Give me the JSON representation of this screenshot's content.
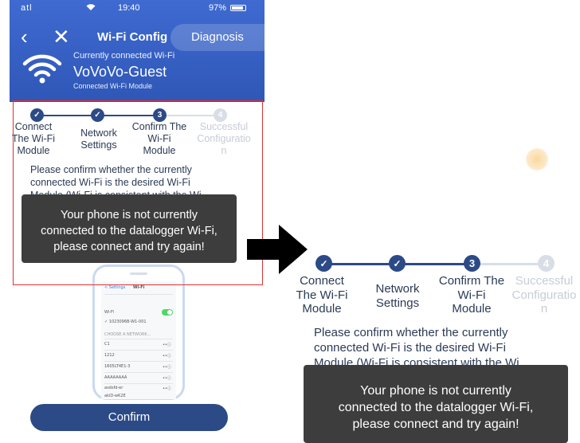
{
  "status_bar": {
    "signal": "atl",
    "time": "19:40",
    "battery": "97%"
  },
  "header": {
    "title": "Wi-Fi Config",
    "diagnosis_label": "Diagnosis",
    "current_label": "Currently connected Wi-Fi",
    "ssid": "VoVoVo-Guest",
    "subtitle": "Connected Wi-Fi Module"
  },
  "steps": [
    {
      "number": "1",
      "line1": "Connect",
      "line2": "The Wi-Fi",
      "line3": "Module",
      "state": "done"
    },
    {
      "number": "2",
      "line1": "Network",
      "line2": "Settings",
      "line3": "",
      "state": "done"
    },
    {
      "number": "3",
      "line1": "Confirm The",
      "line2": "Wi-Fi",
      "line3": "Module",
      "state": "current"
    },
    {
      "number": "4",
      "line1": "Successful",
      "line2": "Configuratio",
      "line3": "n",
      "state": "pending"
    }
  ],
  "message": {
    "line1": "Please confirm whether the currently",
    "line2": "connected Wi-Fi is the desired Wi-Fi",
    "line3": "Module (Wi-Fi is consistent with the Wi"
  },
  "toast": {
    "line1": "Your phone is not currently",
    "line2": "connected to the datalogger Wi-Fi,",
    "line3": "please connect and try again!"
  },
  "illustration": {
    "back_label": "< Settings",
    "screen_title": "Wi-Fi",
    "wifi_label": "Wi-Fi",
    "connected_net": "✓ 1023096B-W1-001",
    "section_label": "CHOOSE A NETWORK...",
    "networks": [
      "C1",
      "1212",
      "1605LT4E1-3",
      "AAAAAAAA",
      "asdsfd-er",
      "akiD-wK2E"
    ]
  },
  "confirm_label": "Confirm",
  "colors": {
    "header": "#3a62c6",
    "primary": "#2c4a86",
    "toast": "#3d3d3d",
    "highlight": "#e03030"
  }
}
